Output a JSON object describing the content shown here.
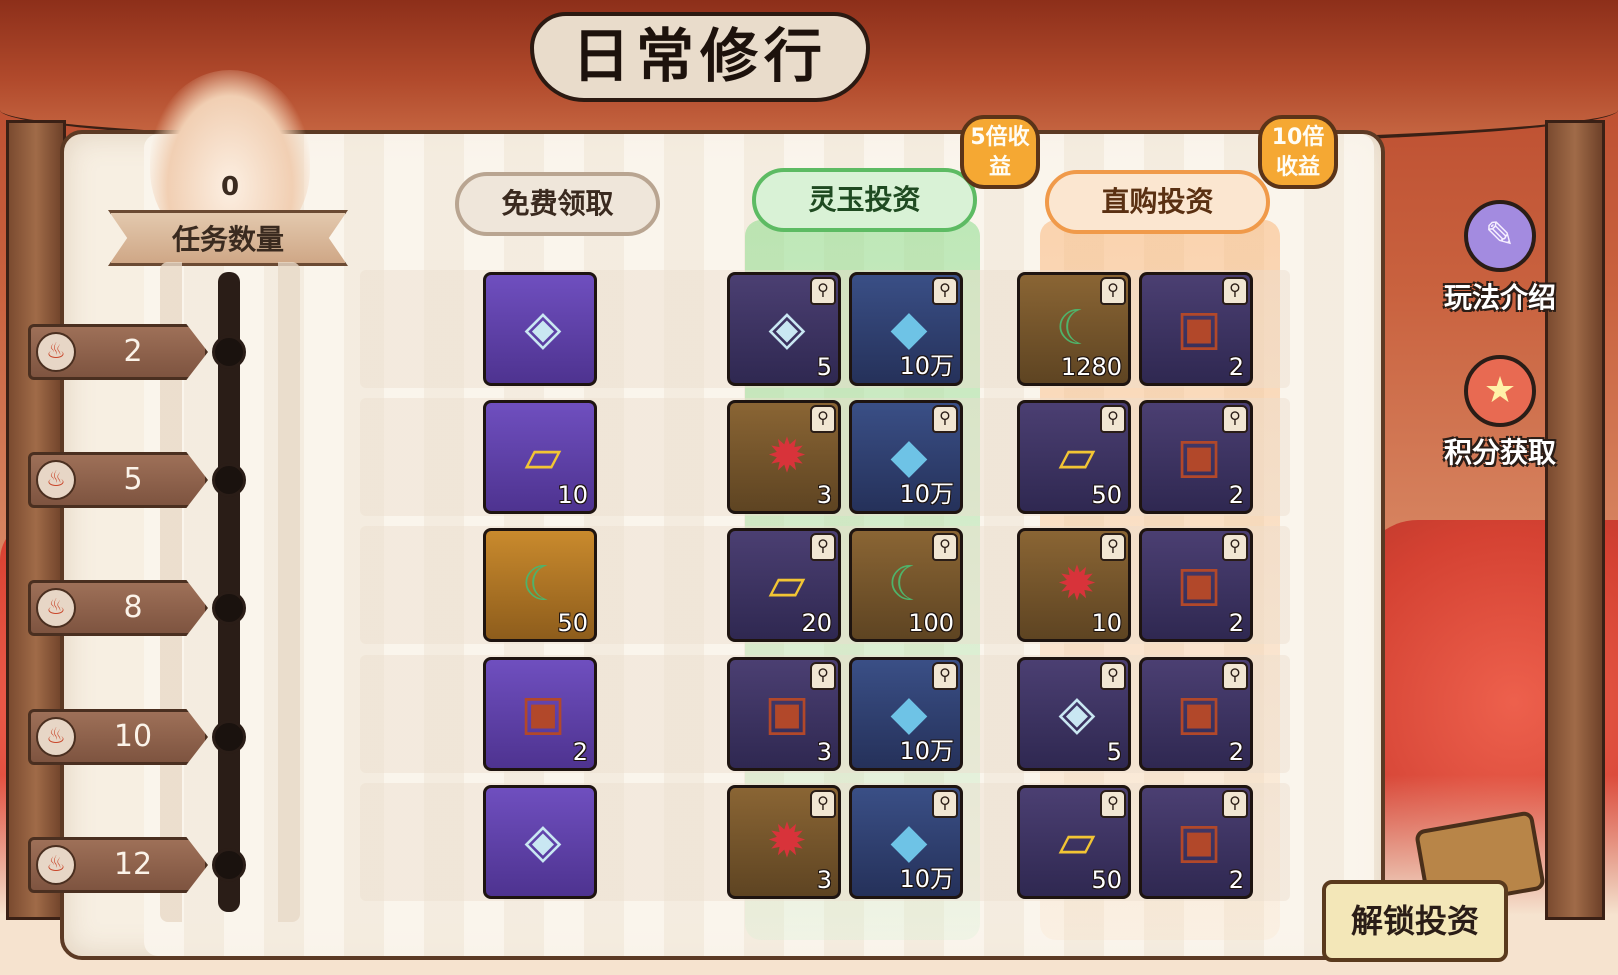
{
  "title": "日常修行",
  "tasks": {
    "count": "0",
    "label": "任务数量"
  },
  "milestones": [
    "2",
    "5",
    "8",
    "10",
    "12"
  ],
  "headers": {
    "free": "免费领取",
    "jade": "灵玉投资",
    "buy": "直购投资"
  },
  "bubbles": {
    "jade": "5倍收益",
    "buy": "10倍收益"
  },
  "side": {
    "rules": "玩法介绍",
    "points": "积分获取"
  },
  "unlock": "解锁投资",
  "icons": {
    "charm": "◈",
    "scroll": "▱",
    "jade": "☾",
    "chest": "▣",
    "crystal": "◆",
    "orb": "✹",
    "lock": "🔒",
    "fire": "♨",
    "rules": "✎",
    "points": "★"
  },
  "rows": [
    {
      "free": {
        "item": "charm",
        "qty": ""
      },
      "jade": [
        {
          "item": "charm",
          "qty": "5"
        },
        {
          "item": "crystal",
          "qty": "10万"
        }
      ],
      "buy": [
        {
          "item": "jade",
          "qty": "1280"
        },
        {
          "item": "chest",
          "qty": "2"
        }
      ]
    },
    {
      "free": {
        "item": "scroll",
        "qty": "10"
      },
      "jade": [
        {
          "item": "orb",
          "qty": "3"
        },
        {
          "item": "crystal",
          "qty": "10万"
        }
      ],
      "buy": [
        {
          "item": "scroll",
          "qty": "50"
        },
        {
          "item": "chest",
          "qty": "2"
        }
      ]
    },
    {
      "free": {
        "item": "jade",
        "qty": "50"
      },
      "jade": [
        {
          "item": "scroll",
          "qty": "20"
        },
        {
          "item": "jade",
          "qty": "100"
        }
      ],
      "buy": [
        {
          "item": "orb",
          "qty": "10"
        },
        {
          "item": "chest",
          "qty": "2"
        }
      ]
    },
    {
      "free": {
        "item": "chest",
        "qty": "2"
      },
      "jade": [
        {
          "item": "chest",
          "qty": "3"
        },
        {
          "item": "crystal",
          "qty": "10万"
        }
      ],
      "buy": [
        {
          "item": "charm",
          "qty": "5"
        },
        {
          "item": "chest",
          "qty": "2"
        }
      ]
    },
    {
      "free": {
        "item": "charm",
        "qty": ""
      },
      "jade": [
        {
          "item": "orb",
          "qty": "3"
        },
        {
          "item": "crystal",
          "qty": "10万"
        }
      ],
      "buy": [
        {
          "item": "scroll",
          "qty": "50"
        },
        {
          "item": "chest",
          "qty": "2"
        }
      ]
    }
  ]
}
